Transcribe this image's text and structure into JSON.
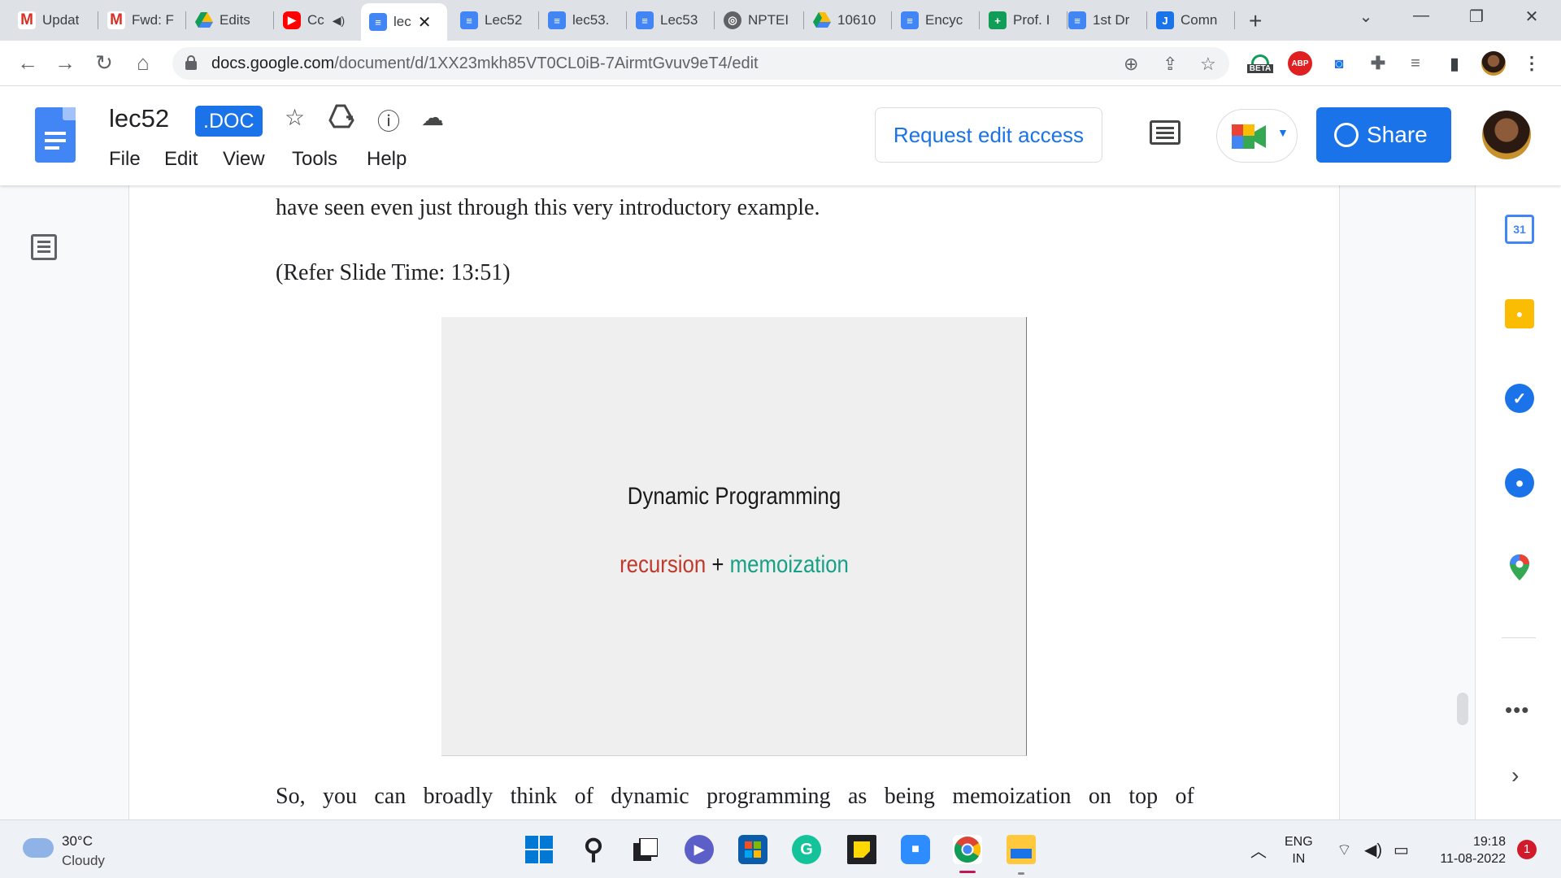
{
  "browser": {
    "tabs": [
      {
        "favicon": "gmail-icon",
        "title": "Updat"
      },
      {
        "favicon": "gmail-icon",
        "title": "Fwd: F"
      },
      {
        "favicon": "drive-icon",
        "title": "Edits"
      },
      {
        "favicon": "youtube-icon",
        "title": "Cc"
      },
      {
        "favicon": "docs-icon",
        "title": "lec"
      },
      {
        "favicon": "docs-icon",
        "title": "Lec52"
      },
      {
        "favicon": "docs-icon",
        "title": "lec53."
      },
      {
        "favicon": "docs-icon",
        "title": "Lec53"
      },
      {
        "favicon": "globe-icon",
        "title": "NPTEI"
      },
      {
        "favicon": "drive-icon",
        "title": "10610"
      },
      {
        "favicon": "docs-icon",
        "title": "Encyc"
      },
      {
        "favicon": "sheets-icon",
        "title": "Prof. I"
      },
      {
        "favicon": "docs-icon",
        "title": "1st Dr"
      },
      {
        "favicon": "jira-icon",
        "title": "Comn"
      }
    ],
    "active_tab_index": 4,
    "new_tab_symbol": "+",
    "url_domain": "docs.google.com",
    "url_path": "/document/d/1XX23mkh85VT0CL0iB-7AirmtGvuv9eT4/edit",
    "ext_beta_label": "BETA",
    "ext_abp_label": "ABP"
  },
  "doc": {
    "title": "lec52",
    "badge": ".DOC",
    "menu": [
      "File",
      "Edit",
      "View",
      "Tools",
      "Help"
    ],
    "request_edit_label": "Request edit access",
    "share_label": "Share"
  },
  "content": {
    "para_top": "have seen even just through this very introductory example.",
    "slide_time": "(Refer Slide Time: 13:51)",
    "slide_title": "Dynamic Programming",
    "slide_sub_recursion": "recursion",
    "slide_sub_plus": "+",
    "slide_sub_memo": "memoization",
    "para_bottom_words": [
      "So,",
      "you",
      "can",
      "broadly",
      "think",
      "of",
      "dynamic",
      "programming",
      "as",
      "being",
      "memoization",
      "on",
      "top",
      "of"
    ]
  },
  "side_panel": {
    "calendar_day": "31",
    "more_label": "•••",
    "expand_label": "›"
  },
  "taskbar": {
    "temperature": "30°C",
    "weather": "Cloudy",
    "lang_line1": "ENG",
    "lang_line2": "IN",
    "time": "19:18",
    "date": "11-08-2022",
    "notifications": "1"
  },
  "colors": {
    "docs_blue": "#4285f4",
    "share_blue": "#1a73e8",
    "recursion_red": "#c0392b",
    "memoization_green": "#16a085"
  }
}
